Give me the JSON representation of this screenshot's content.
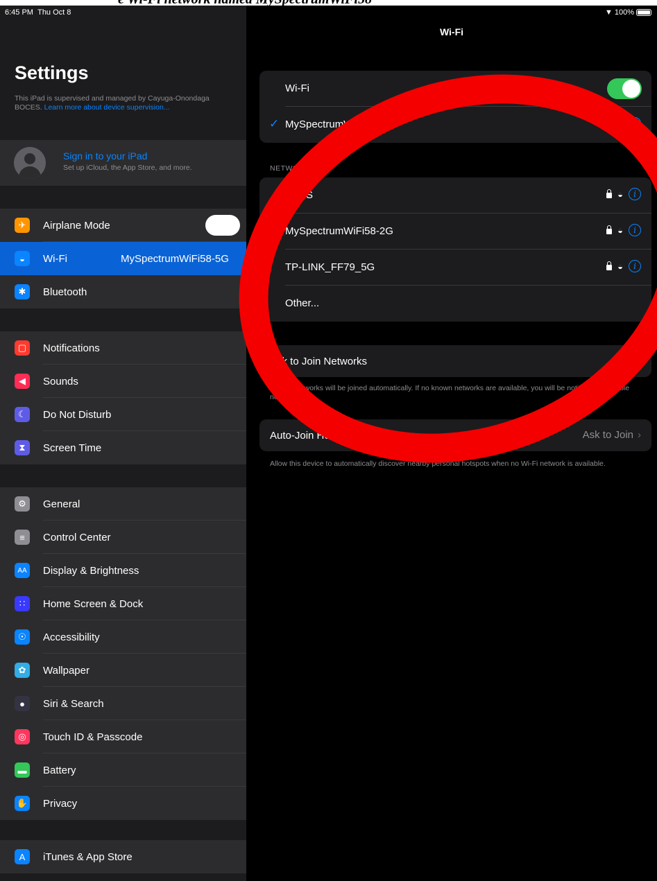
{
  "caption_fragment": "e Wi-Fi network named MySpectrumWiFi58",
  "status": {
    "time": "6:45 PM",
    "date": "Thu Oct 8",
    "battery": "100%"
  },
  "sidebar": {
    "title": "Settings",
    "note_text": "This iPad is supervised and managed by Cayuga-Onondaga BOCES. ",
    "note_link": "Learn more about device supervision...",
    "profile": {
      "title": "Sign in to your iPad",
      "subtitle": "Set up iCloud, the App Store, and more."
    },
    "group1": [
      {
        "label": "Airplane Mode",
        "icon": "airplane-icon",
        "color": "#ff9500"
      },
      {
        "label": "Wi-Fi",
        "value": "MySpectrumWiFi58-5G",
        "icon": "wifi-icon",
        "color": "#0a84ff"
      },
      {
        "label": "Bluetooth",
        "icon": "bluetooth-icon",
        "color": "#0a84ff"
      }
    ],
    "group2": [
      {
        "label": "Notifications",
        "icon": "notifications-icon",
        "color": "#ff3b30"
      },
      {
        "label": "Sounds",
        "icon": "speaker-icon",
        "color": "#ff2d55"
      },
      {
        "label": "Do Not Disturb",
        "icon": "moon-icon",
        "color": "#5e5ce6"
      },
      {
        "label": "Screen Time",
        "icon": "hourglass-icon",
        "color": "#5e5ce6"
      }
    ],
    "group3": [
      {
        "label": "General",
        "icon": "gear-icon",
        "color": "#8e8e93"
      },
      {
        "label": "Control Center",
        "icon": "switches-icon",
        "color": "#8e8e93"
      },
      {
        "label": "Display & Brightness",
        "icon": "text-size-icon",
        "color": "#0a84ff"
      },
      {
        "label": "Home Screen & Dock",
        "icon": "grid-icon",
        "color": "#3a3aff"
      },
      {
        "label": "Accessibility",
        "icon": "accessibility-icon",
        "color": "#0a84ff"
      },
      {
        "label": "Wallpaper",
        "icon": "flower-icon",
        "color": "#32ade6"
      },
      {
        "label": "Siri & Search",
        "icon": "siri-icon",
        "color": "#333344"
      },
      {
        "label": "Touch ID & Passcode",
        "icon": "fingerprint-icon",
        "color": "#ff375f"
      },
      {
        "label": "Battery",
        "icon": "battery-icon",
        "color": "#34c759"
      },
      {
        "label": "Privacy",
        "icon": "hand-icon",
        "color": "#0a84ff"
      }
    ],
    "group4": [
      {
        "label": "iTunes & App Store",
        "icon": "app-store-icon",
        "color": "#0a84ff"
      }
    ]
  },
  "main": {
    "title": "Wi-Fi",
    "wifi_label": "Wi-Fi",
    "connected": "MySpectrumWiFi58-5G",
    "networks_header": "NETWORKS",
    "networks": [
      "ABBS",
      "MySpectrumWiFi58-2G",
      "TP-LINK_FF79_5G"
    ],
    "other": "Other...",
    "auto_join_networks": "Ask to Join Networks",
    "auto_join_networks_note": "Known networks will be joined automatically. If no known networks are available, you will be notified of available networks.",
    "auto_join_hotspot": "Auto-Join Hotspot",
    "auto_join_hotspot_value": "Ask to Join",
    "auto_join_hotspot_note": "Allow this device to automatically discover nearby personal hotspots when no Wi-Fi network is available."
  },
  "colors": {
    "accent": "#0a84ff",
    "toggle_on": "#34c759",
    "annotation": "#f40000"
  }
}
